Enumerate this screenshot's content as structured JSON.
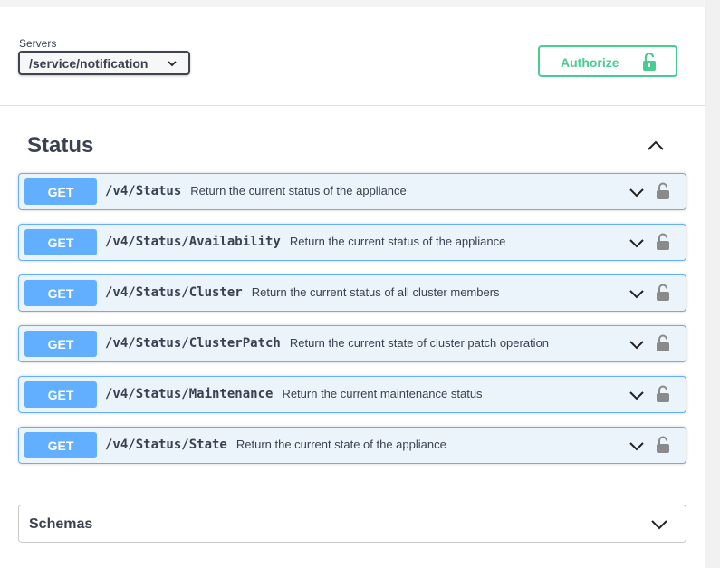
{
  "servers": {
    "label": "Servers",
    "selected": "/service/notification"
  },
  "authorize": {
    "label": "Authorize",
    "color": "#49cc90"
  },
  "tag": {
    "name": "Status"
  },
  "operations": [
    {
      "method": "GET",
      "path": "/v4/Status",
      "summary": "Return the current status of the appliance"
    },
    {
      "method": "GET",
      "path": "/v4/Status/Availability",
      "summary": "Return the current status of the appliance"
    },
    {
      "method": "GET",
      "path": "/v4/Status/Cluster",
      "summary": "Return the current status of all cluster members"
    },
    {
      "method": "GET",
      "path": "/v4/Status/ClusterPatch",
      "summary": "Return the current state of cluster patch operation"
    },
    {
      "method": "GET",
      "path": "/v4/Status/Maintenance",
      "summary": "Return the current maintenance status"
    },
    {
      "method": "GET",
      "path": "/v4/Status/State",
      "summary": "Return the current state of the appliance"
    }
  ],
  "schemas": {
    "title": "Schemas"
  },
  "colors": {
    "get_method": "#61affe",
    "get_background": "#ebf3fb",
    "text": "#3b4151"
  },
  "icons": {
    "server_select": "chevron-down-icon",
    "authorize": "lock-open-icon",
    "tag_toggle": "chevron-up-icon",
    "operation_toggle": "chevron-down-icon",
    "operation_auth": "lock-icon",
    "schemas_toggle": "chevron-down-icon"
  }
}
